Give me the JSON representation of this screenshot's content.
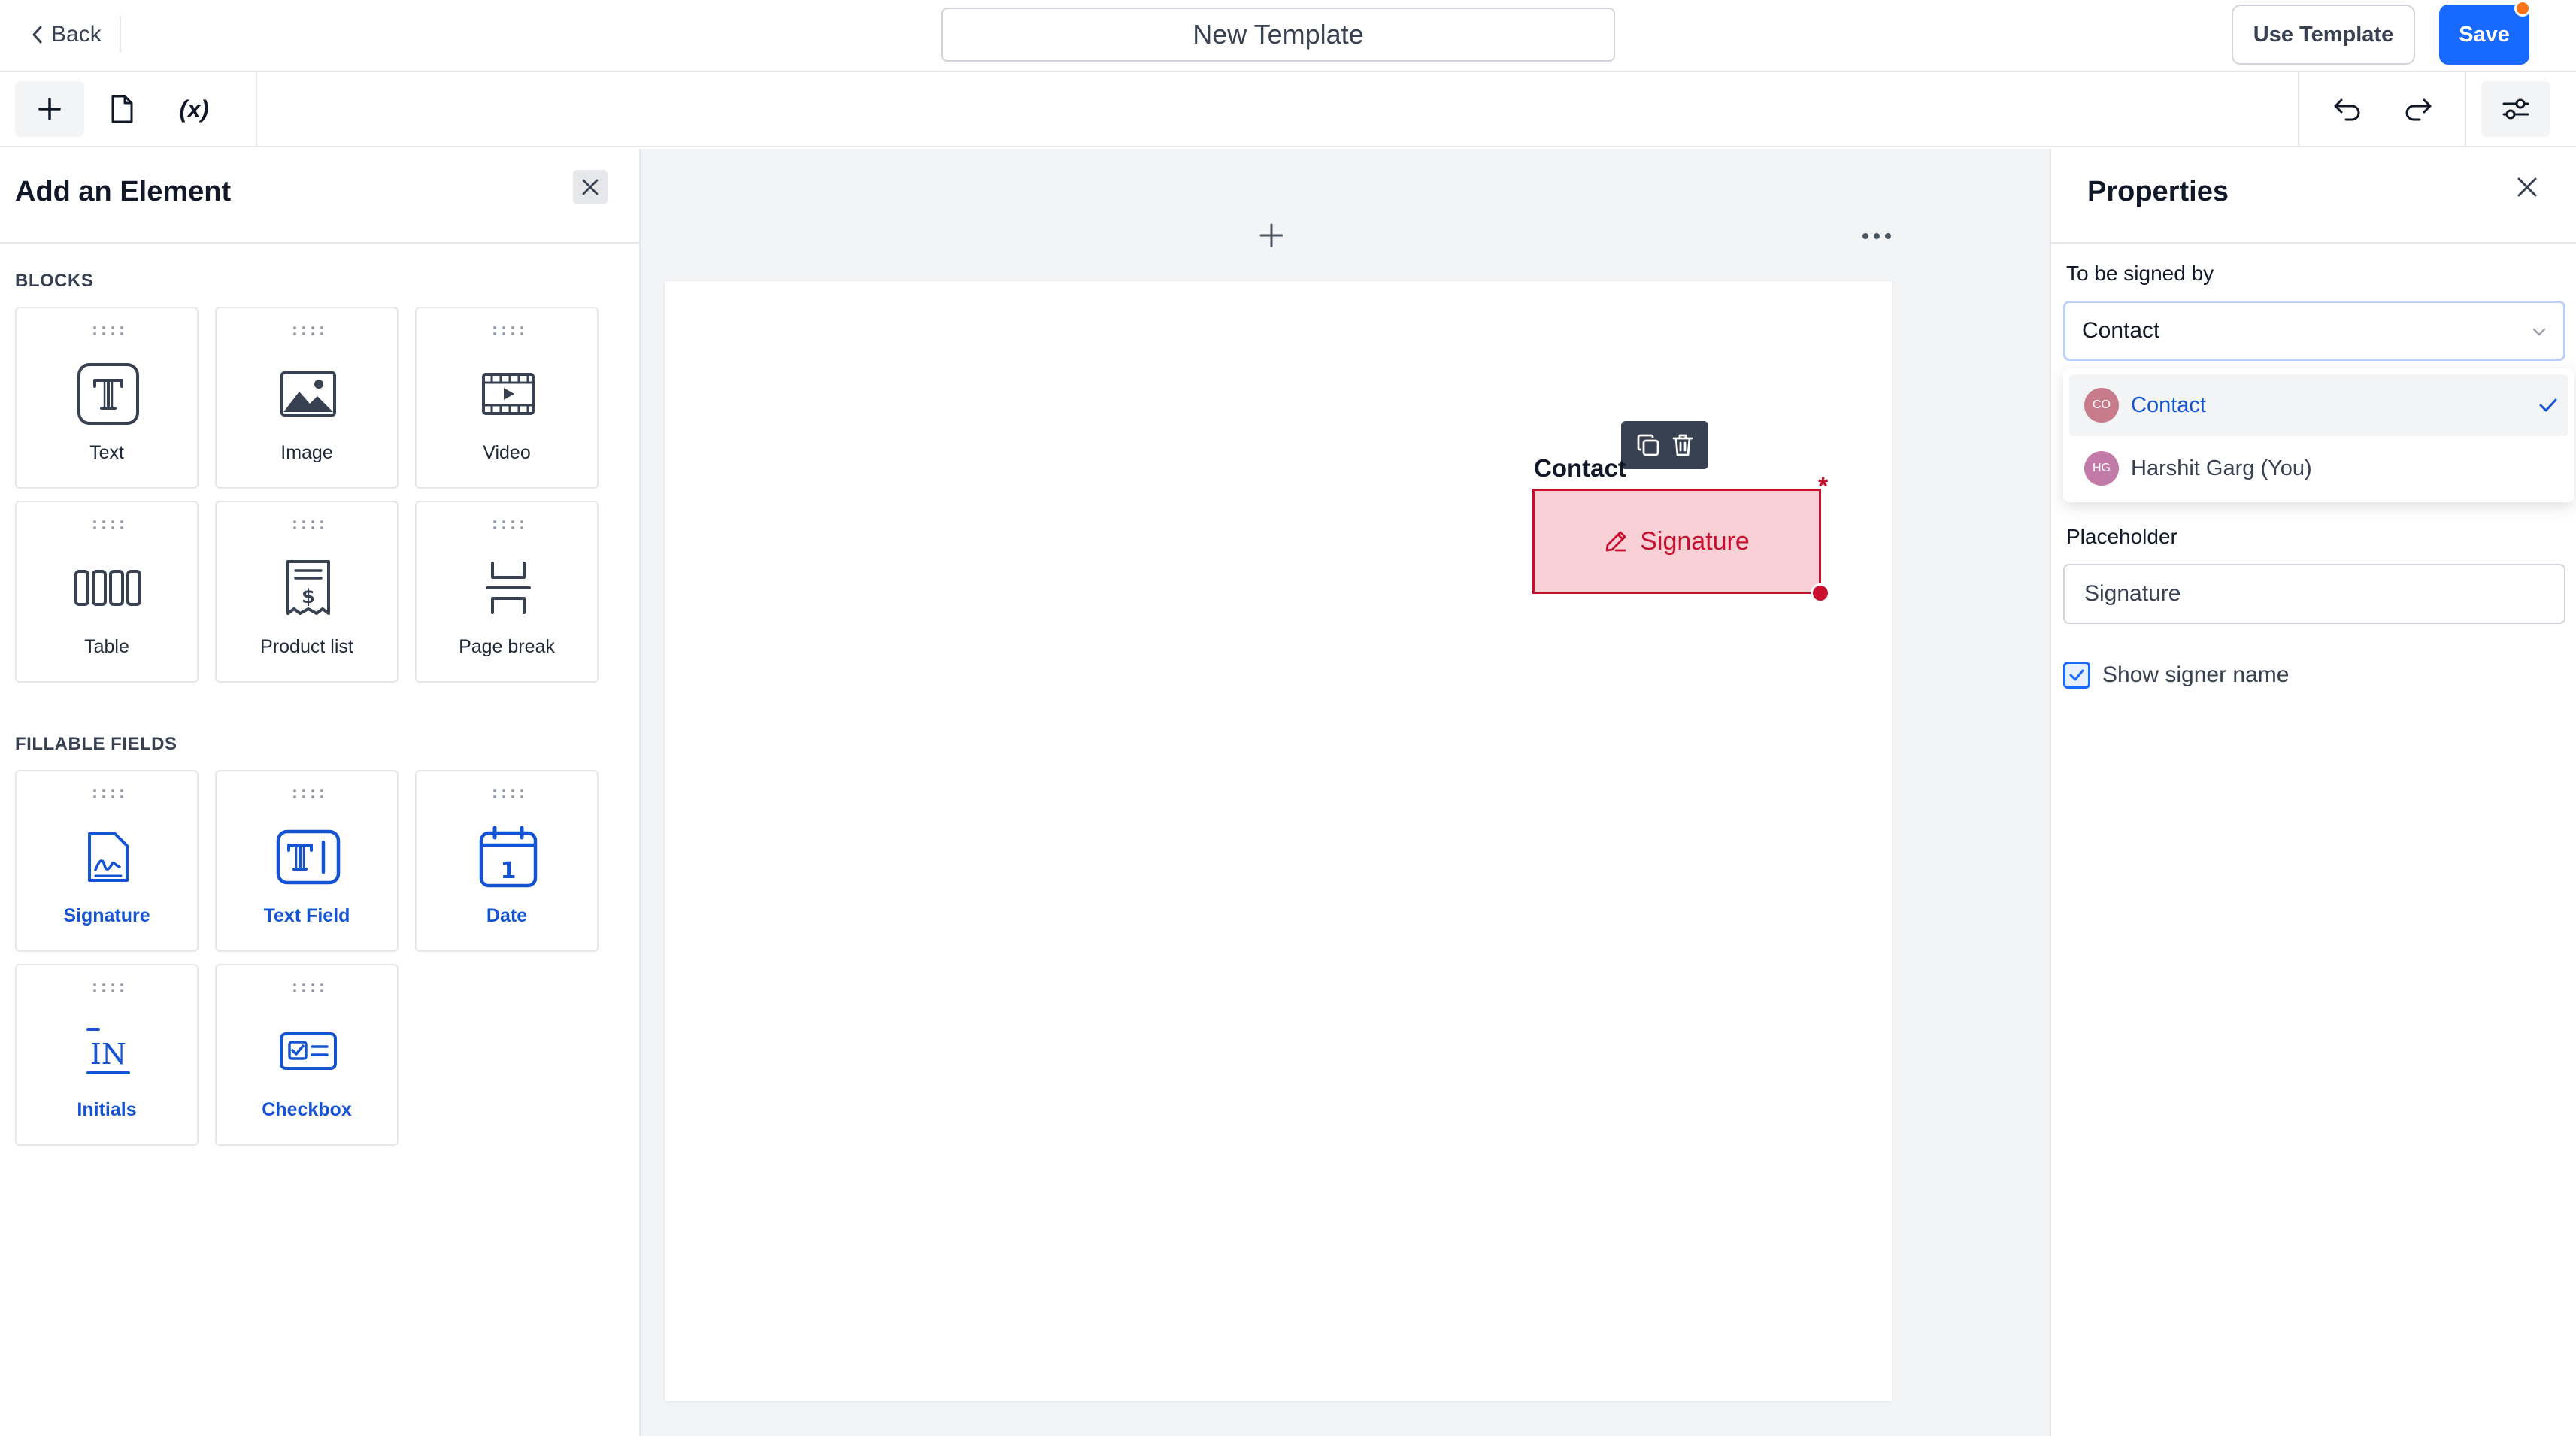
{
  "header": {
    "back_label": "Back",
    "title": "New Template",
    "use_template_label": "Use Template",
    "save_label": "Save",
    "colors": {
      "primary": "#1769ff",
      "notification": "#f97316"
    }
  },
  "toolbar": {
    "left_buttons": [
      "plus-icon",
      "page-icon",
      "variables"
    ],
    "variables_label": "(x)",
    "right_buttons": [
      "undo-icon",
      "redo-icon",
      "settings-sliders-icon"
    ]
  },
  "left_panel": {
    "title": "Add an Element",
    "blocks_label": "BLOCKS",
    "blocks": [
      {
        "label": "Text",
        "icon": "text-icon"
      },
      {
        "label": "Image",
        "icon": "image-icon"
      },
      {
        "label": "Video",
        "icon": "video-icon"
      },
      {
        "label": "Table",
        "icon": "table-icon"
      },
      {
        "label": "Product list",
        "icon": "product-list-icon"
      },
      {
        "label": "Page break",
        "icon": "page-break-icon"
      }
    ],
    "fields_label": "FILLABLE FIELDS",
    "fields": [
      {
        "label": "Signature",
        "icon": "signature-icon"
      },
      {
        "label": "Text Field",
        "icon": "text-field-icon"
      },
      {
        "label": "Date",
        "icon": "date-icon"
      },
      {
        "label": "Initials",
        "icon": "initials-icon"
      },
      {
        "label": "Checkbox",
        "icon": "checkbox-icon"
      }
    ],
    "date_icon_text": "1",
    "initials_icon_text": "IN"
  },
  "canvas": {
    "field_signer_label": "Contact",
    "field_placeholder": "Signature",
    "required_marker": "*",
    "colors": {
      "field_fill": "#f9d0d6",
      "field_border": "#c8102e"
    }
  },
  "right_panel": {
    "title": "Properties",
    "signed_by_label": "To be signed by",
    "signed_by_value": "Contact",
    "options": [
      {
        "label": "Contact",
        "initials": "CO",
        "selected": true,
        "avatar_color": "#c77b8b"
      },
      {
        "label": "Harshit Garg (You)",
        "initials": "HG",
        "selected": false,
        "avatar_color": "#c27aa8"
      }
    ],
    "placeholder_label": "Placeholder",
    "placeholder_value": "Signature",
    "show_signer_label": "Show signer name",
    "show_signer_checked": true
  }
}
